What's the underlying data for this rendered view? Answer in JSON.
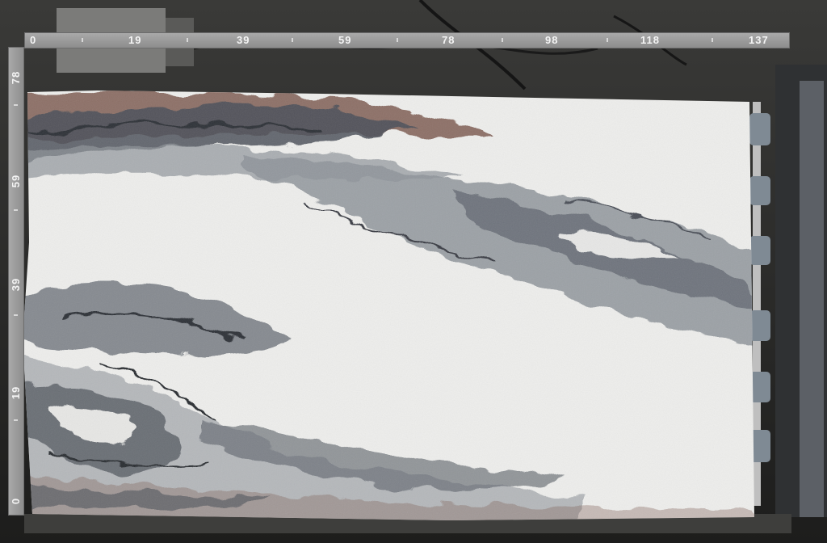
{
  "ruler_horizontal": {
    "unit_labels": [
      "0",
      "19",
      "39",
      "59",
      "78",
      "98",
      "118",
      "137"
    ]
  },
  "ruler_vertical": {
    "unit_labels": [
      "78",
      "59",
      "39",
      "19",
      "0"
    ]
  },
  "colors": {
    "background": "#2a2a29",
    "slab_base": "#eeeeec",
    "vein_gray": "#8d9399",
    "vein_dark": "#4b5058",
    "vein_brown": "#7b5b4f",
    "ruler": "#9a9a9a"
  }
}
